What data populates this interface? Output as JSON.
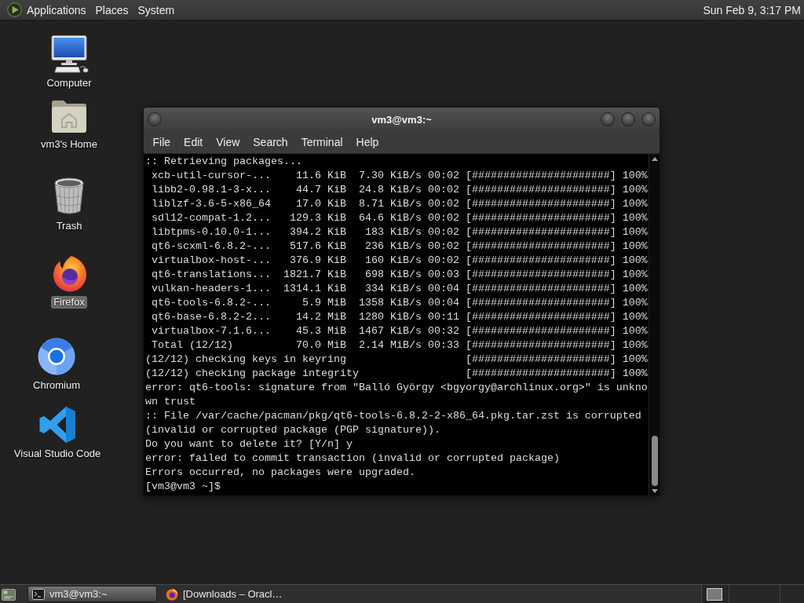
{
  "top_panel": {
    "menus": [
      "Applications",
      "Places",
      "System"
    ],
    "clock": "Sun Feb 9, 3:17 PM"
  },
  "desktop_icons": [
    {
      "kind": "computer",
      "label": "Computer",
      "selected": false
    },
    {
      "kind": "home",
      "label": "vm3's Home",
      "selected": false
    },
    {
      "kind": "trash",
      "label": "Trash",
      "selected": false
    },
    {
      "kind": "firefox",
      "label": "Firefox",
      "selected": true
    },
    {
      "kind": "chromium",
      "label": "Chromium",
      "selected": false
    },
    {
      "kind": "vscode",
      "label": "Visual Studio Code",
      "selected": false
    }
  ],
  "terminal": {
    "title": "vm3@vm3:~",
    "menu": [
      "File",
      "Edit",
      "View",
      "Search",
      "Terminal",
      "Help"
    ],
    "lines": [
      ":: Retrieving packages...",
      " xcb-util-cursor-...    11.6 KiB  7.30 KiB/s 00:02 [######################] 100%",
      " libb2-0.98.1-3-x...    44.7 KiB  24.8 KiB/s 00:02 [######################] 100%",
      " liblzf-3.6-5-x86_64    17.0 KiB  8.71 KiB/s 00:02 [######################] 100%",
      " sdl12-compat-1.2...   129.3 KiB  64.6 KiB/s 00:02 [######################] 100%",
      " libtpms-0.10.0-1...   394.2 KiB   183 KiB/s 00:02 [######################] 100%",
      " qt6-scxml-6.8.2-...   517.6 KiB   236 KiB/s 00:02 [######################] 100%",
      " virtualbox-host-...   376.9 KiB   160 KiB/s 00:02 [######################] 100%",
      " qt6-translations...  1821.7 KiB   698 KiB/s 00:03 [######################] 100%",
      " vulkan-headers-1...  1314.1 KiB   334 KiB/s 00:04 [######################] 100%",
      " qt6-tools-6.8.2-...     5.9 MiB  1358 KiB/s 00:04 [######################] 100%",
      " qt6-base-6.8.2-2...    14.2 MiB  1280 KiB/s 00:11 [######################] 100%",
      " virtualbox-7.1.6...    45.3 MiB  1467 KiB/s 00:32 [######################] 100%",
      " Total (12/12)          70.0 MiB  2.14 MiB/s 00:33 [######################] 100%",
      "(12/12) checking keys in keyring                   [######################] 100%",
      "(12/12) checking package integrity                 [######################] 100%",
      "error: qt6-tools: signature from \"Balló György <bgyorgy@archlinux.org>\" is unkno",
      "wn trust",
      ":: File /var/cache/pacman/pkg/qt6-tools-6.8.2-2-x86_64.pkg.tar.zst is corrupted",
      "(invalid or corrupted package (PGP signature)).",
      "Do you want to delete it? [Y/n] y",
      "error: failed to commit transaction (invalid or corrupted package)",
      "Errors occurred, no packages were upgraded.",
      "[vm3@vm3 ~]$"
    ]
  },
  "taskbar": {
    "tasks": [
      {
        "kind": "terminal",
        "label": "vm3@vm3:~",
        "selected": true
      },
      {
        "kind": "firefox",
        "label": "[Downloads – Oracl…",
        "selected": false
      }
    ]
  }
}
